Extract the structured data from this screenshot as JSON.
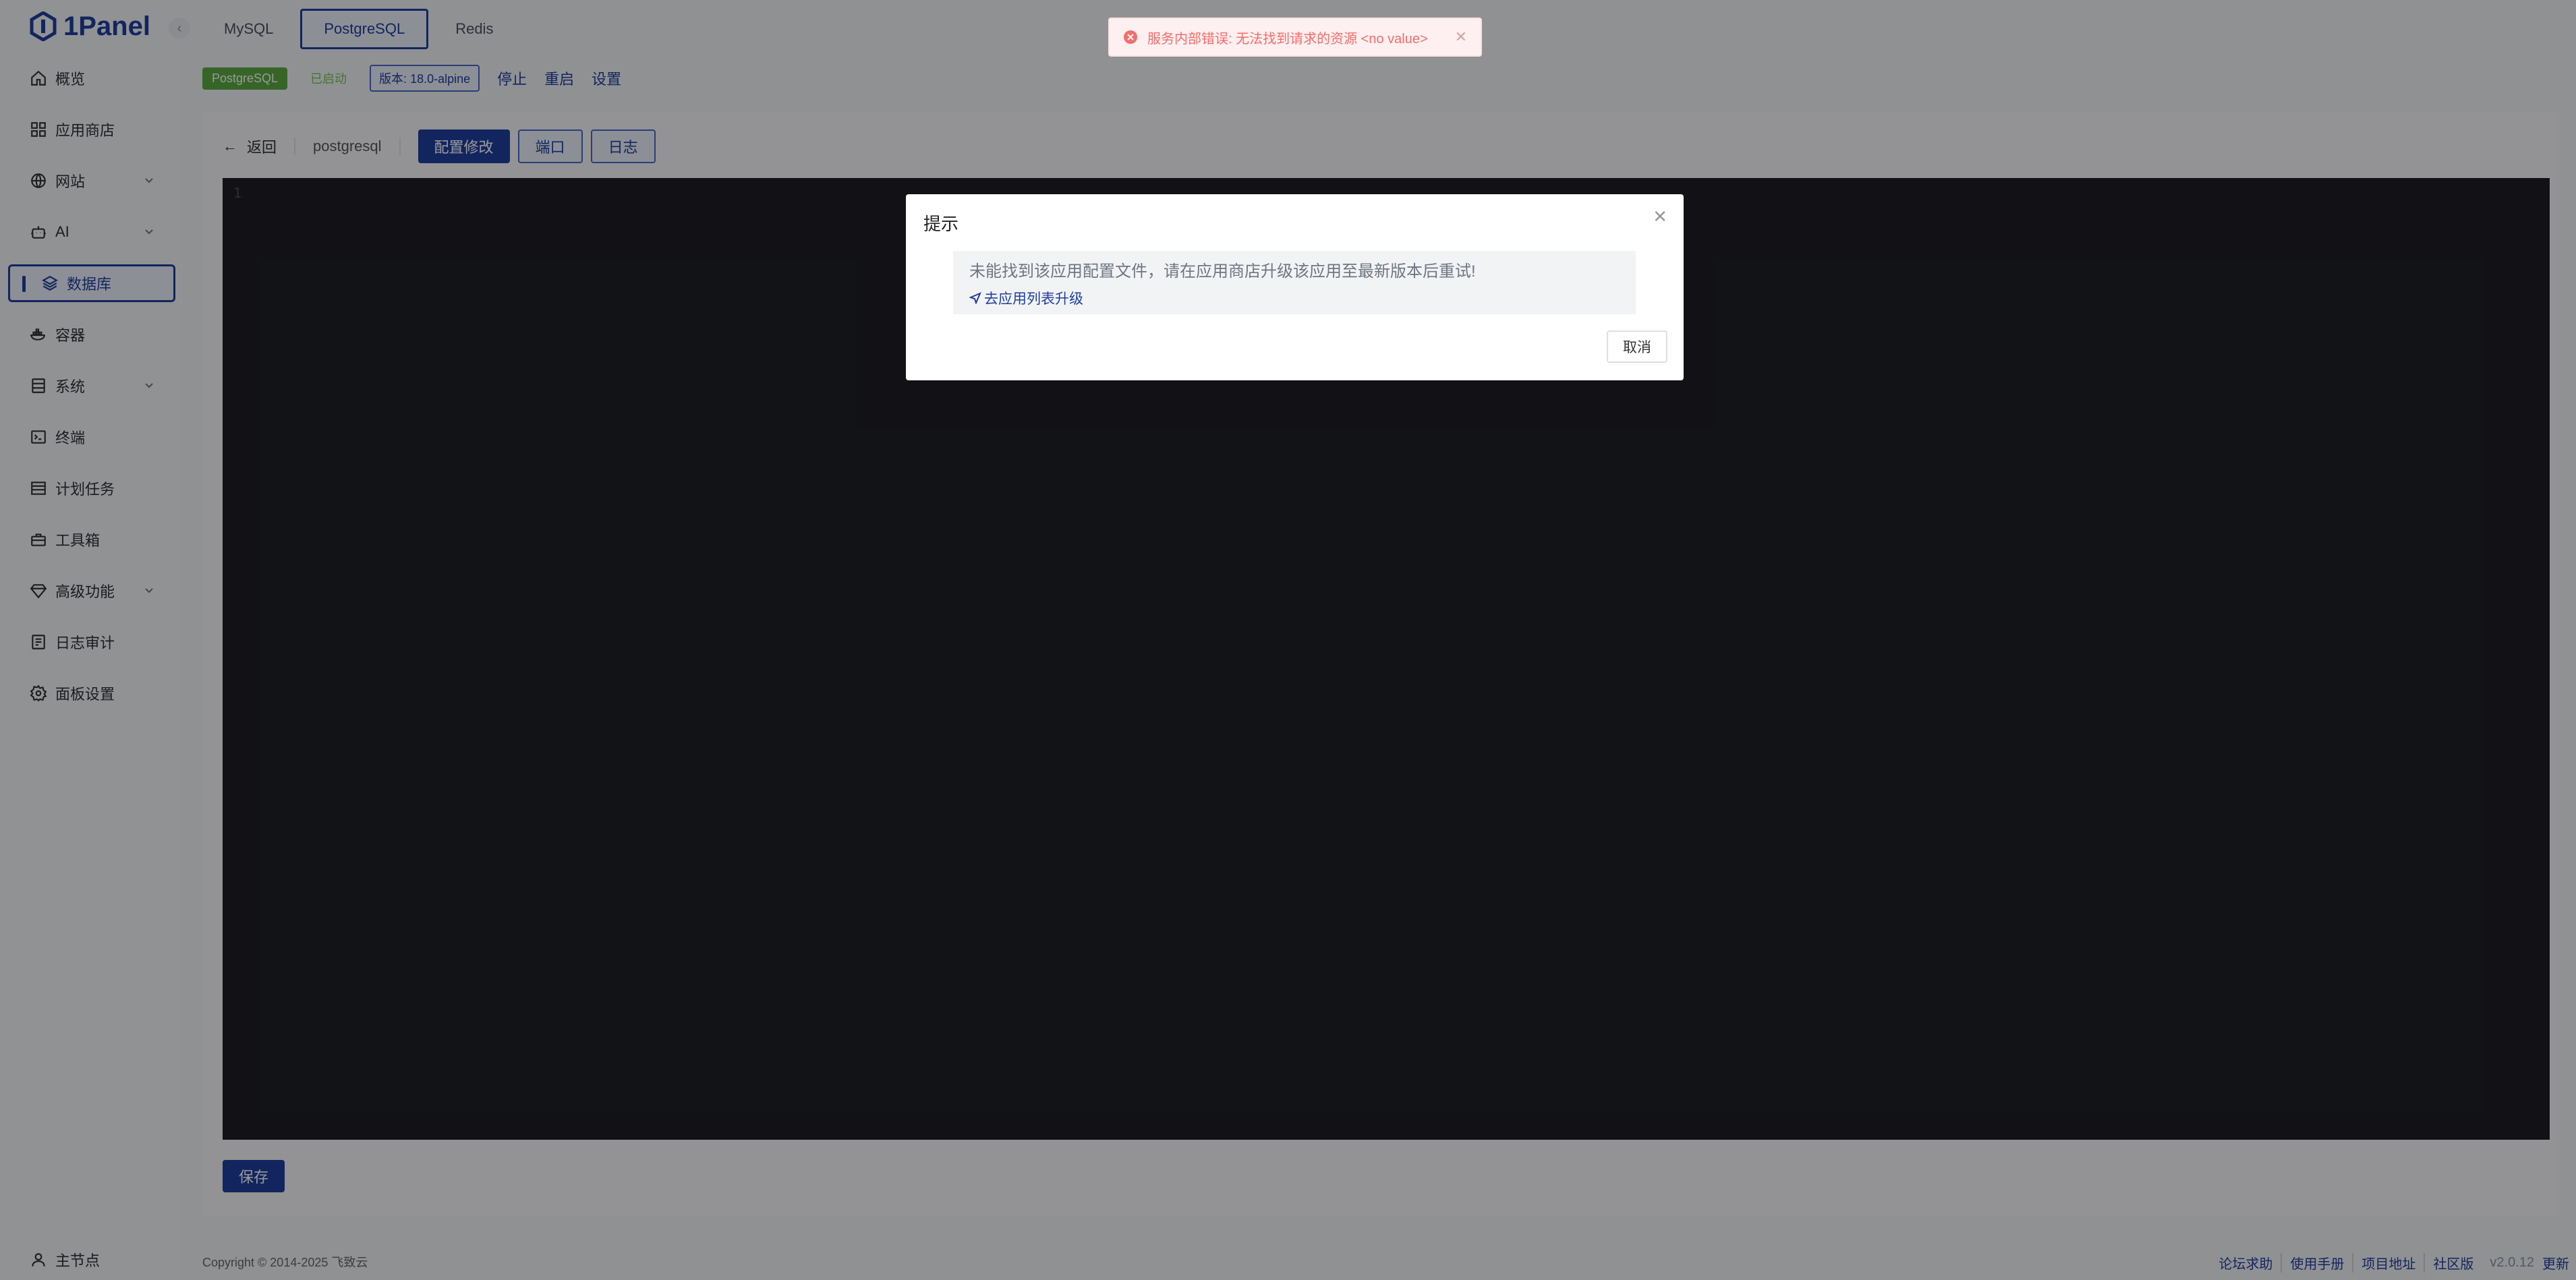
{
  "app": {
    "name": "1Panel"
  },
  "sidebar": {
    "items": [
      {
        "label": "概览",
        "icon": "home-icon"
      },
      {
        "label": "应用商店",
        "icon": "grid-icon"
      },
      {
        "label": "网站",
        "icon": "globe-icon",
        "expandable": true
      },
      {
        "label": "AI",
        "icon": "robot-icon",
        "expandable": true
      },
      {
        "label": "数据库",
        "icon": "database-icon",
        "active": true
      },
      {
        "label": "容器",
        "icon": "container-icon"
      },
      {
        "label": "系统",
        "icon": "system-icon",
        "expandable": true
      },
      {
        "label": "终端",
        "icon": "terminal-icon"
      },
      {
        "label": "计划任务",
        "icon": "list-icon"
      },
      {
        "label": "工具箱",
        "icon": "toolbox-icon"
      },
      {
        "label": "高级功能",
        "icon": "diamond-icon",
        "expandable": true
      },
      {
        "label": "日志审计",
        "icon": "log-icon"
      },
      {
        "label": "面板设置",
        "icon": "gear-icon"
      }
    ],
    "node": {
      "label": "主节点",
      "icon": "user-icon"
    }
  },
  "tabs": [
    {
      "label": "MySQL"
    },
    {
      "label": "PostgreSQL",
      "active": true
    },
    {
      "label": "Redis"
    }
  ],
  "status_bar": {
    "app_tag": "PostgreSQL",
    "state": "已启动",
    "version": "版本: 18.0-alpine",
    "actions": [
      "停止",
      "重启",
      "设置"
    ]
  },
  "toolbar": {
    "back": "返回",
    "app_name": "postgresql",
    "buttons": [
      "配置修改",
      "端口",
      "日志"
    ]
  },
  "editor": {
    "line_numbers": [
      "1"
    ]
  },
  "save_label": "保存",
  "footer": {
    "copyright": "Copyright © 2014-2025 飞致云",
    "links": [
      "论坛求助",
      "使用手册",
      "项目地址",
      "社区版"
    ],
    "version": "v2.0.12",
    "update": "更新"
  },
  "toast": {
    "message": "服务内部错误: 无法找到请求的资源 <no value>"
  },
  "dialog": {
    "title": "提示",
    "message": "未能找到该应用配置文件，请在应用商店升级该应用至最新版本后重试!",
    "link": "去应用列表升级",
    "cancel": "取消"
  },
  "colors": {
    "primary": "#1f3f9e",
    "success": "#5ba841",
    "error": "#f56c6c",
    "editor_bg": "#1e1f26"
  }
}
